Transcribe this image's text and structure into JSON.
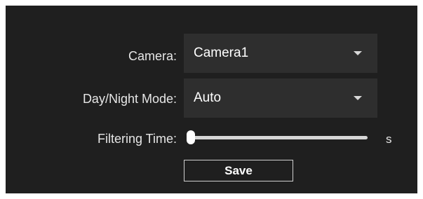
{
  "form": {
    "camera": {
      "label": "Camera:",
      "value": "Camera1"
    },
    "day_night_mode": {
      "label": "Day/Night Mode:",
      "value": "Auto"
    },
    "filtering_time": {
      "label": "Filtering Time:",
      "value_fraction": 0,
      "unit": "s"
    },
    "save_label": "Save"
  },
  "icons": {
    "dropdown": "chevron-down-icon"
  },
  "colors": {
    "background": "#1f1f1f",
    "field_background": "#2e2e2e",
    "text": "#e6e6e6",
    "slider_track": "#d6d6d6"
  }
}
